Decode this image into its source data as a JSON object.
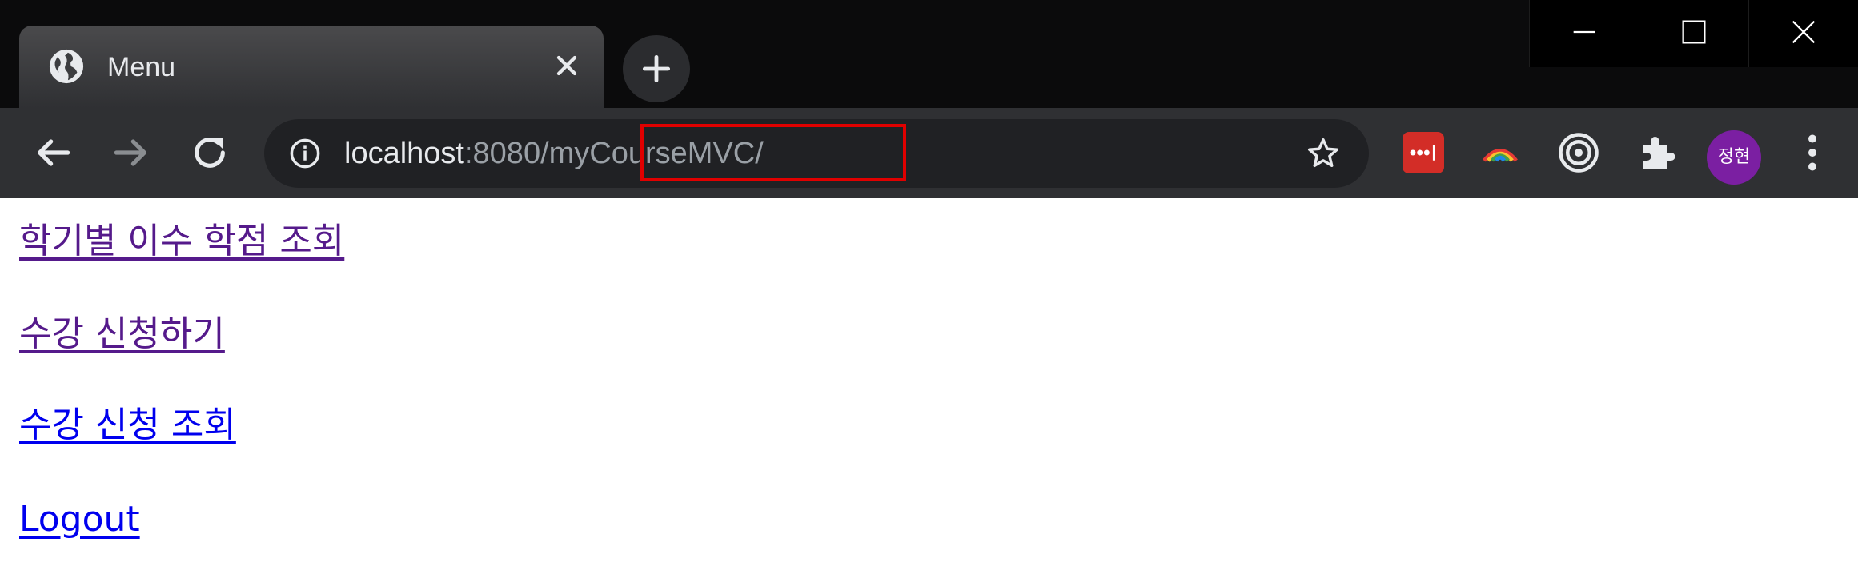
{
  "window": {
    "tab_title": "Menu",
    "controls": [
      "minimize-icon",
      "maximize-icon",
      "close-icon"
    ]
  },
  "toolbar": {
    "url_host": "localhost",
    "url_port": ":8080",
    "url_path": "/myCourseMVC/",
    "icons": [
      "back-icon",
      "forward-icon",
      "reload-icon",
      "info-icon",
      "bookmark-star-icon",
      "lastpass-icon",
      "rainbow-extension-icon",
      "target-extension-icon",
      "extensions-puzzle-icon",
      "profile-avatar",
      "more-menu-icon"
    ],
    "profile_initials": "정현",
    "colors": {
      "highlight_box": "#e00000",
      "avatar_bg": "#7b1fa2",
      "lastpass_bg": "#d32d27"
    }
  },
  "menu": {
    "links": [
      {
        "label": "학기별 이수 학점 조회",
        "visited": true
      },
      {
        "label": "수강 신청하기",
        "visited": true
      },
      {
        "label": "수강 신청 조회",
        "visited": false
      },
      {
        "label": "Logout",
        "visited": false
      }
    ],
    "colors": {
      "visited": "#551a8b",
      "unvisited": "#0000ee"
    }
  }
}
